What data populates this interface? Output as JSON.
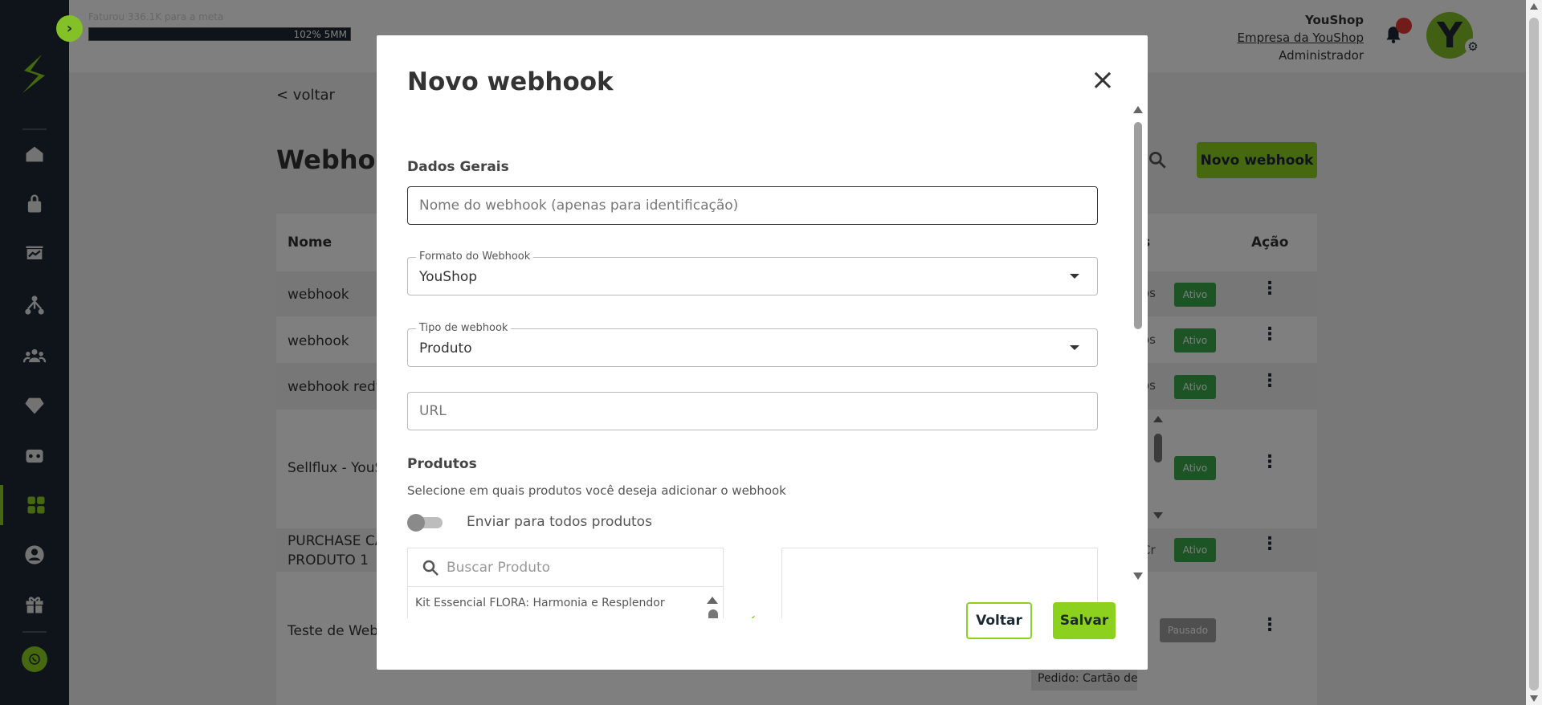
{
  "topbar": {
    "billing_text": "Faturou 336.1K para a meta",
    "billing_progress_label": "102%",
    "billing_goal": "5MM",
    "user_name": "YouShop",
    "company": "Empresa da YouShop",
    "role": "Administrador",
    "avatar_letter": "Y"
  },
  "page": {
    "back_link": "< voltar",
    "title": "Webhook",
    "new_button": "Novo webhook",
    "columns": {
      "name": "Nome",
      "status_fragment": "s",
      "action": "Ação"
    },
    "rows": [
      {
        "name": "webhook",
        "fragment": "os",
        "status": "Ativo"
      },
      {
        "name": "webhook",
        "fragment": "os",
        "status": "Ativo"
      },
      {
        "name": "webhook redt",
        "fragment": "os",
        "status": "Ativo"
      },
      {
        "name": "Sellflux - YouS",
        "fragment": "",
        "status": "Ativo"
      },
      {
        "name": "PURCHASE CA",
        "name_line2": "PRODUTO 1",
        "fragment": "Cr",
        "status": "Ativo"
      },
      {
        "name": "Teste de Webh",
        "fragment": "",
        "status": "Pausado"
      }
    ],
    "order_tag": "Pedido: Cartão de"
  },
  "modal": {
    "title": "Novo webhook",
    "section_general": "Dados Gerais",
    "name_placeholder": "Nome do webhook (apenas para identificação)",
    "format_label": "Formato do Webhook",
    "format_value": "YouShop",
    "type_label": "Tipo de webhook",
    "type_value": "Produto",
    "url_placeholder": "URL",
    "section_products": "Produtos",
    "products_description": "Selecione em quais produtos você deseja adicionar o webhook",
    "send_all_label": "Enviar para todos produtos",
    "send_all_enabled": false,
    "product_search_placeholder": "Buscar Produto",
    "products": [
      "Kit Essencial FLORA: Harmonia e Resplendor"
    ],
    "back_button": "Voltar",
    "save_button": "Salvar"
  },
  "colors": {
    "accent": "#8dd11f",
    "sidebar": "#1c2833",
    "active": "#3aa84d",
    "paused": "#9e9e9e"
  }
}
